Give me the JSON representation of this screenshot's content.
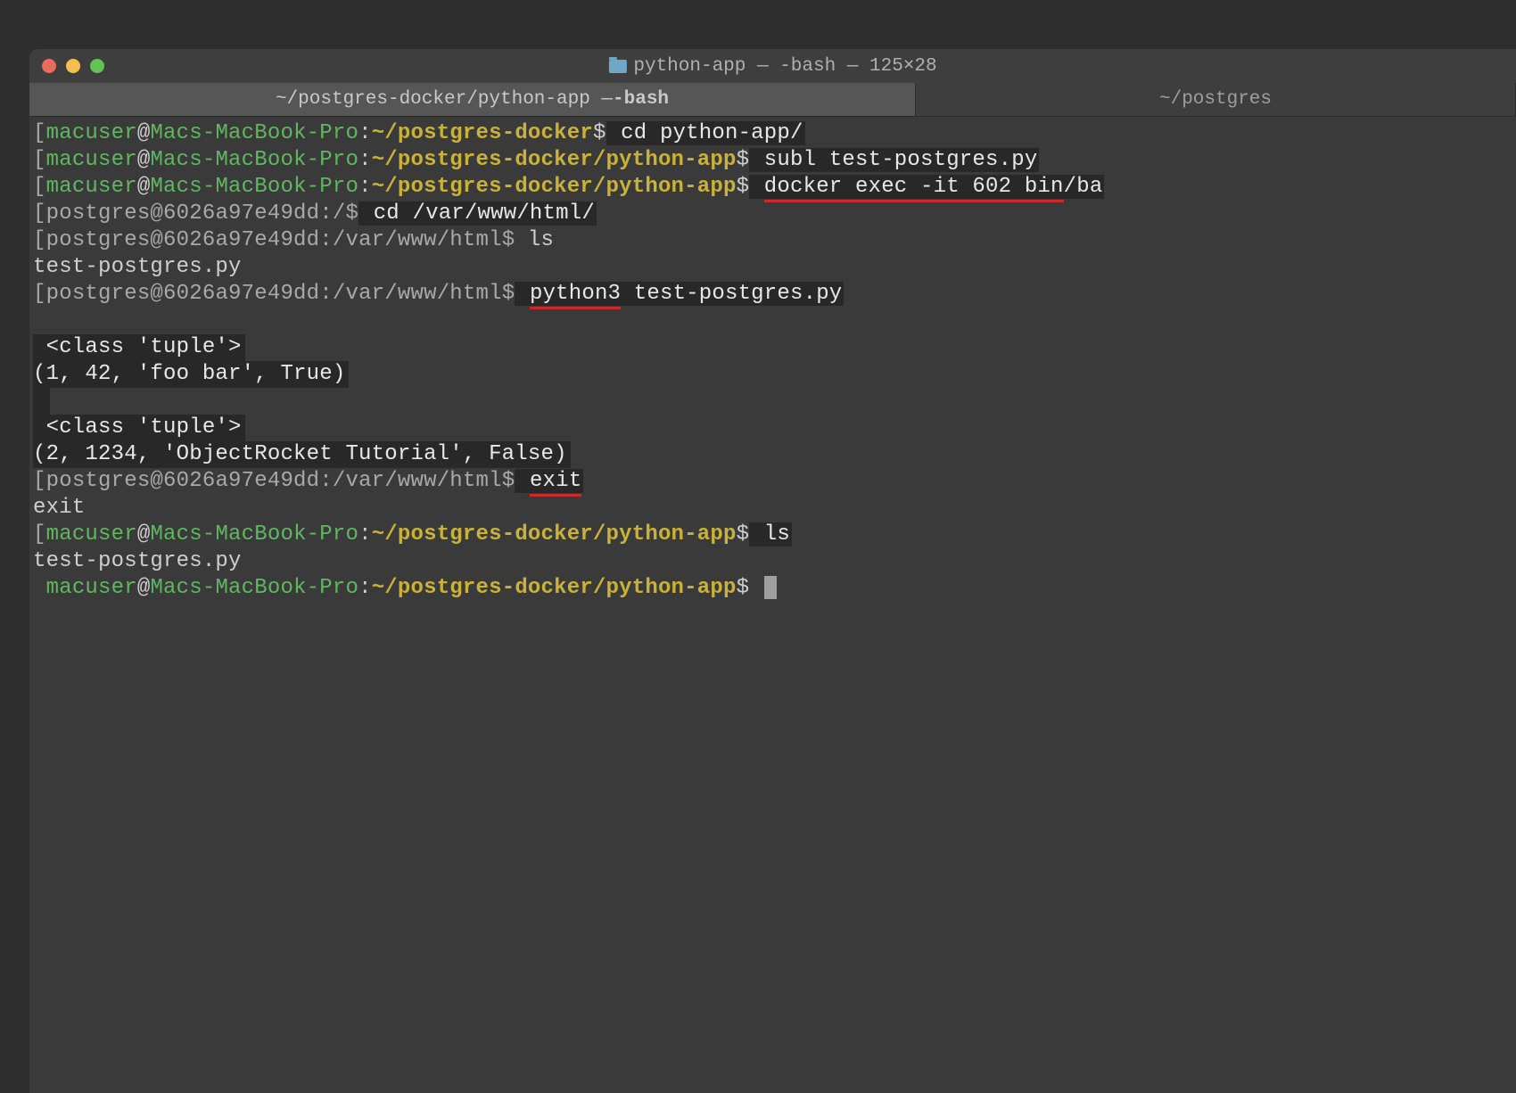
{
  "window": {
    "title_prefix": "python-app — -bash — 125×28"
  },
  "tabs": {
    "active": {
      "path": "~/postgres-docker/python-app — ",
      "suffix": "-bash"
    },
    "inactive": "~/postgres"
  },
  "prompts": {
    "mac": {
      "user": "macuser",
      "at": "@",
      "host": "Macs-MacBook-Pro",
      "colon": ":",
      "dollar": "$"
    },
    "paths": {
      "pg_docker": "~/postgres-docker",
      "python_app": "~/postgres-docker/python-app"
    },
    "docker": {
      "user_host": "postgres@6026a97e49dd",
      "root": "/",
      "html": "/var/www/html",
      "dollar": "$"
    }
  },
  "commands": {
    "cd_python_app": " cd python-app/",
    "subl": " subl test-postgres.py",
    "docker_exec": " docker exec -it 602 bin/ba",
    "cd_html": " cd /var/www/html/",
    "ls_container": " ls",
    "python3": " python3",
    "python3_arg": " test-postgres.py",
    "exit": " exit",
    "ls_host": " ls"
  },
  "underlined": {
    "docker_exec": "docker exec -it 602 bin",
    "python3": "python3",
    "exit": "exit"
  },
  "output": {
    "test_postgres": "test-postgres.py",
    "class_tuple_1": " <class 'tuple'>",
    "row1": "(1, 42, 'foo bar', True)",
    "class_tuple_2": " <class 'tuple'>",
    "row2": "(2, 1234, 'ObjectRocket Tutorial', False)",
    "exit_echo": "exit",
    "ls_host_result": "test-postgres.py"
  }
}
